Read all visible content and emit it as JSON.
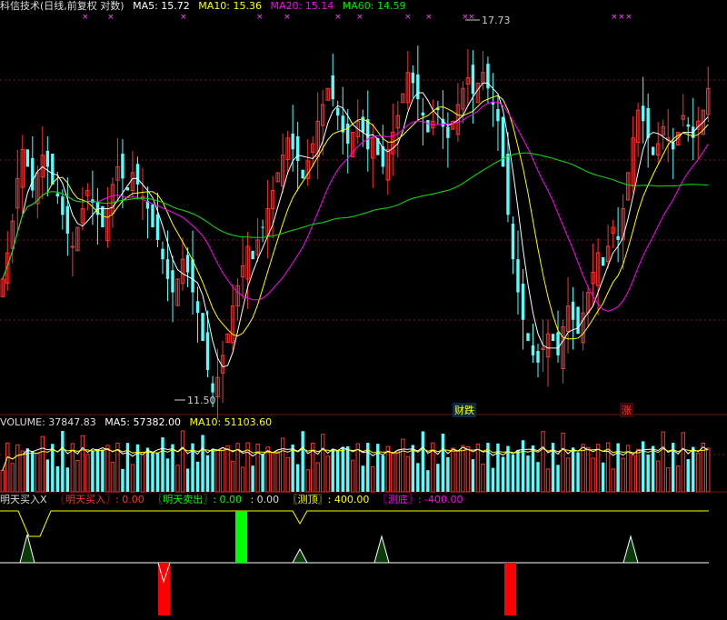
{
  "header": {
    "title": "科信技术(日线,前复权 对数)",
    "ma5": "MA5: 15.72",
    "ma10": "MA10: 15.36",
    "ma20": "MA20: 15.14",
    "ma60": "MA60: 14.59"
  },
  "price_high_label": "17.73",
  "price_low_label": "11.50",
  "signals": {
    "fall": "财跌",
    "rise": "涨"
  },
  "volume_header": {
    "label": "VOLUME: 37847.83",
    "ma5": "MA5: 57382.00",
    "ma10": "MA10: 51103.60"
  },
  "indicator_header": {
    "name": "明天买入X",
    "buy": "〖明天买入〗: 0.00",
    "sell": "〖明天卖出〗: 0.00",
    "extra": ": 0.00",
    "top": "〖测顶〗: 400.00",
    "bottom": "〖测底〗: -400.00"
  },
  "colors": {
    "up": "#ff3232",
    "down": "#54ffff",
    "ma5": "#ffffff",
    "ma10": "#ffff00",
    "ma20": "#ff00ff",
    "ma60": "#00e600",
    "grid": "#7a1414",
    "buy": "#ff0000",
    "sell": "#00ff00"
  },
  "chart_data": {
    "type": "candlestick",
    "scale": "log",
    "ylim": [
      11.5,
      17.73
    ],
    "closes": [
      13.2,
      13.6,
      14.1,
      14.8,
      15.3,
      15.0,
      14.6,
      14.9,
      15.2,
      15.0,
      14.7,
      14.5,
      14.2,
      13.9,
      13.7,
      14.0,
      14.3,
      14.6,
      14.4,
      14.2,
      14.0,
      14.3,
      14.7,
      15.0,
      14.8,
      14.6,
      14.9,
      14.7,
      14.5,
      14.3,
      14.0,
      13.8,
      13.5,
      13.2,
      13.0,
      13.2,
      13.5,
      13.3,
      13.0,
      12.7,
      12.3,
      11.9,
      11.6,
      11.8,
      12.1,
      12.4,
      12.8,
      13.1,
      13.4,
      13.7,
      13.5,
      13.8,
      14.0,
      14.3,
      14.6,
      14.9,
      15.2,
      15.5,
      15.3,
      15.1,
      14.8,
      15.1,
      15.4,
      15.8,
      16.1,
      16.4,
      16.2,
      15.9,
      15.6,
      15.4,
      15.6,
      15.8,
      15.6,
      15.3,
      15.5,
      15.2,
      15.0,
      15.3,
      15.6,
      15.9,
      16.3,
      16.7,
      16.5,
      16.2,
      15.9,
      15.6,
      15.8,
      16.0,
      15.7,
      15.5,
      15.8,
      16.1,
      16.4,
      16.6,
      16.3,
      16.5,
      16.7,
      16.4,
      16.1,
      15.8,
      15.0,
      14.2,
      13.5,
      13.0,
      12.6,
      12.3,
      12.1,
      12.0,
      12.2,
      12.4,
      12.3,
      12.1,
      12.5,
      12.8,
      12.6,
      12.4,
      12.7,
      13.0,
      13.3,
      13.6,
      13.4,
      13.7,
      14.0,
      13.8,
      14.3,
      14.9,
      15.5,
      16.0,
      15.8,
      15.5,
      15.2,
      15.4,
      15.7,
      15.5,
      15.3,
      15.6,
      15.9,
      15.7,
      15.5,
      15.8,
      16.0,
      16.4
    ]
  }
}
